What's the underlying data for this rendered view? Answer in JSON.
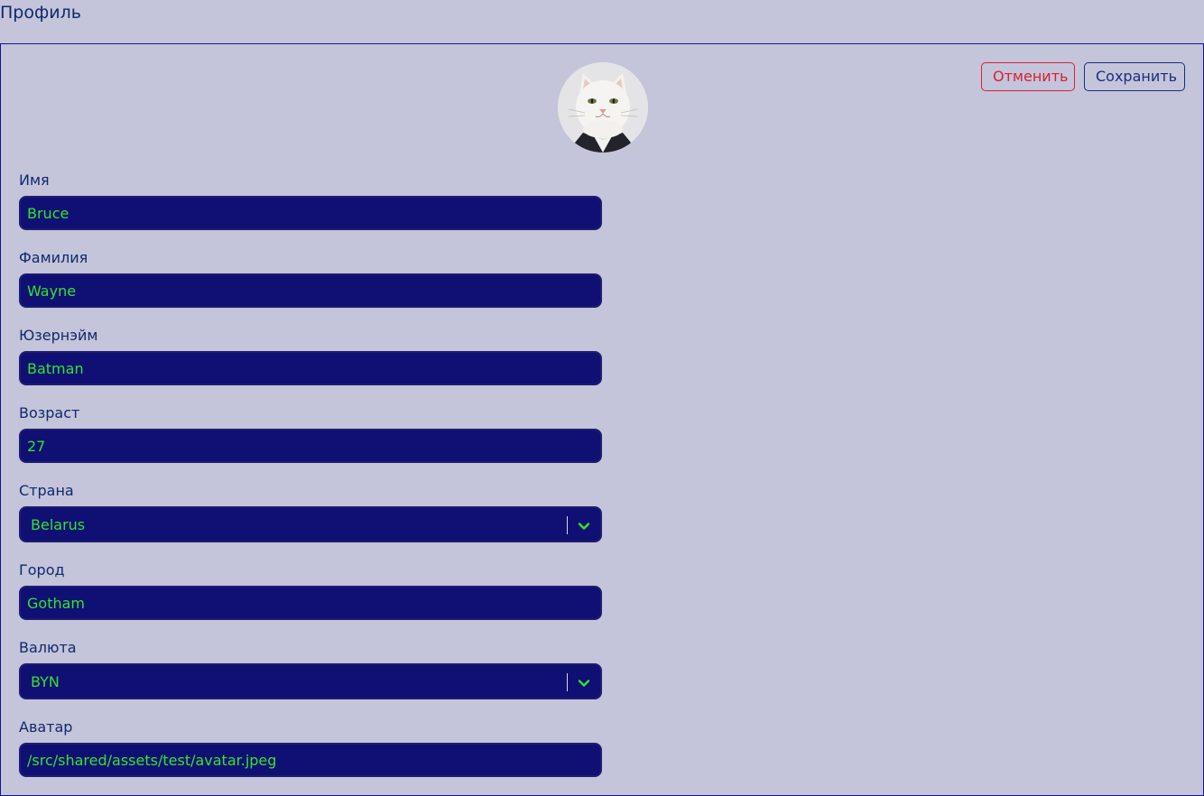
{
  "page": {
    "title": "Профиль"
  },
  "actions": {
    "cancel_label": "Отменить",
    "save_label": "Сохранить"
  },
  "form": {
    "first_name": {
      "label": "Имя",
      "value": "Bruce"
    },
    "last_name": {
      "label": "Фамилия",
      "value": "Wayne"
    },
    "username": {
      "label": "Юзернэйм",
      "value": "Batman"
    },
    "age": {
      "label": "Возраст",
      "value": "27"
    },
    "country": {
      "label": "Страна",
      "value": "Belarus"
    },
    "city": {
      "label": "Город",
      "value": "Gotham"
    },
    "currency": {
      "label": "Валюта",
      "value": "BYN"
    },
    "avatar": {
      "label": "Аватар",
      "value": "/src/shared/assets/test/avatar.jpeg"
    }
  },
  "icons": {
    "avatar_image": "cat-avatar-image",
    "dropdown": "chevron-down-icon"
  },
  "colors": {
    "background": "#c4c4da",
    "input_bg": "#100f74",
    "input_text": "#2ee62e",
    "cancel": "#d3232f",
    "primary_text": "#0e2a6b",
    "card_border": "#16168a"
  }
}
